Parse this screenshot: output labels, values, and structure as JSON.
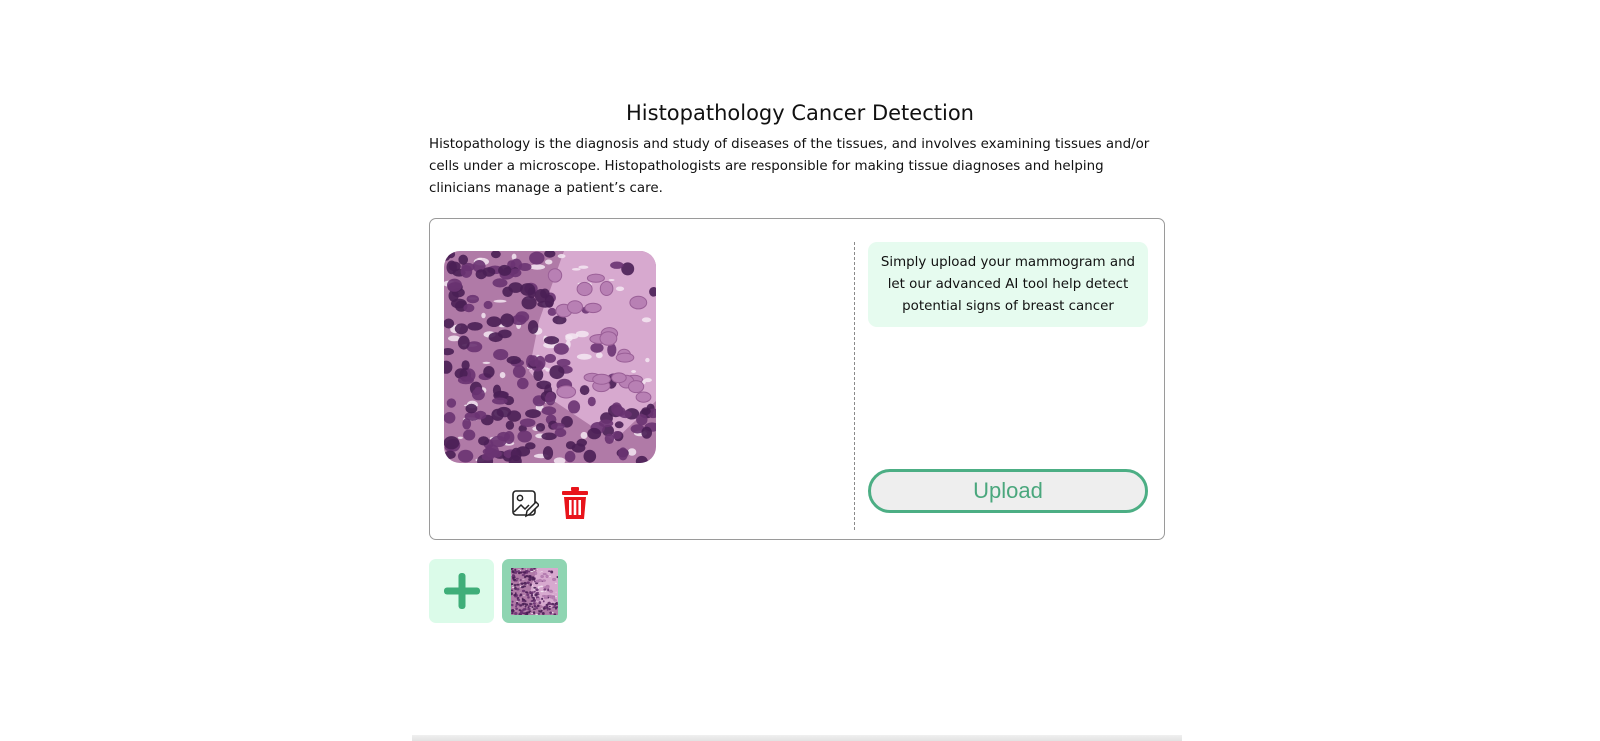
{
  "page": {
    "title": "Histopathology Cancer Detection",
    "intro": "Histopathology is the diagnosis and study of diseases of the tissues, and involves examining tissues and/or cells under a microscope. Histopathologists are responsible for making tissue diagnoses and helping clinicians manage a patient’s care."
  },
  "panel": {
    "info_text": "Simply upload your mammogram and let our advanced AI tool help detect potential signs of breast cancer",
    "upload_label": "Upload",
    "edit_icon": "image-edit-icon",
    "delete_icon": "trash-icon"
  },
  "gallery": {
    "add_icon": "plus-icon"
  },
  "colors": {
    "accent_green": "#4cae84",
    "info_bg": "#e6fbef",
    "add_tile_bg": "#dbfbe9",
    "selected_tile_bg": "#8fd5b2",
    "delete_red": "#e8141b"
  }
}
